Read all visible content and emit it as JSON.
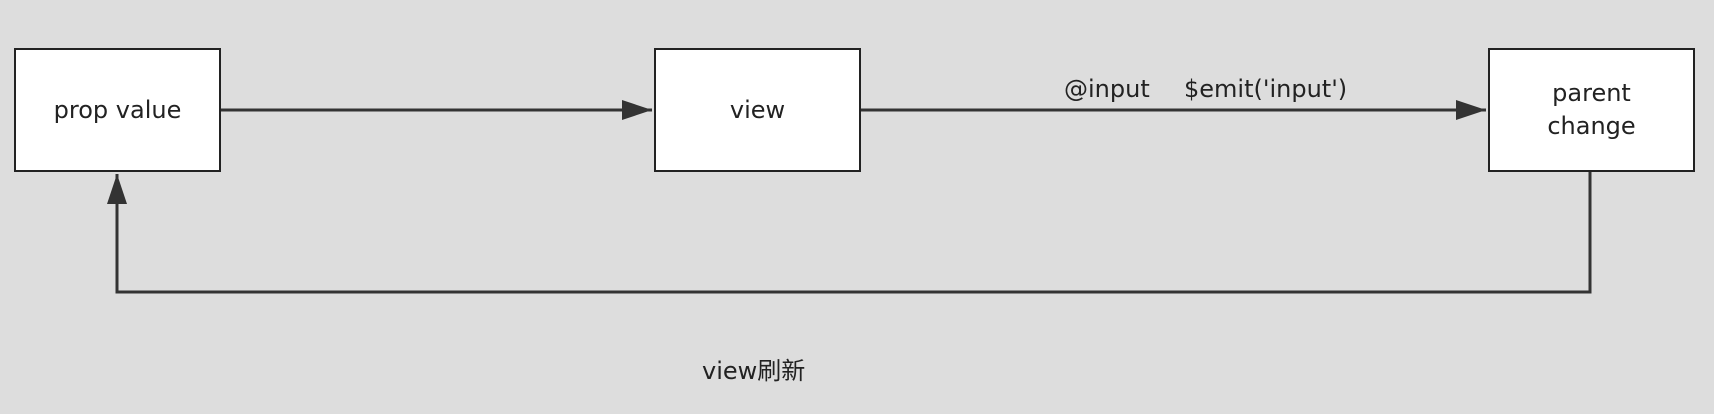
{
  "nodes": {
    "prop_value": "prop value",
    "view": "view",
    "parent_change": "parent\nchange"
  },
  "edges": {
    "view_to_parent_label_1": "@input",
    "view_to_parent_label_2": "$emit('input')",
    "feedback_label": "view刷新"
  },
  "colors": {
    "background": "#dddddd",
    "stroke": "#333333",
    "node_fill": "#ffffff"
  }
}
